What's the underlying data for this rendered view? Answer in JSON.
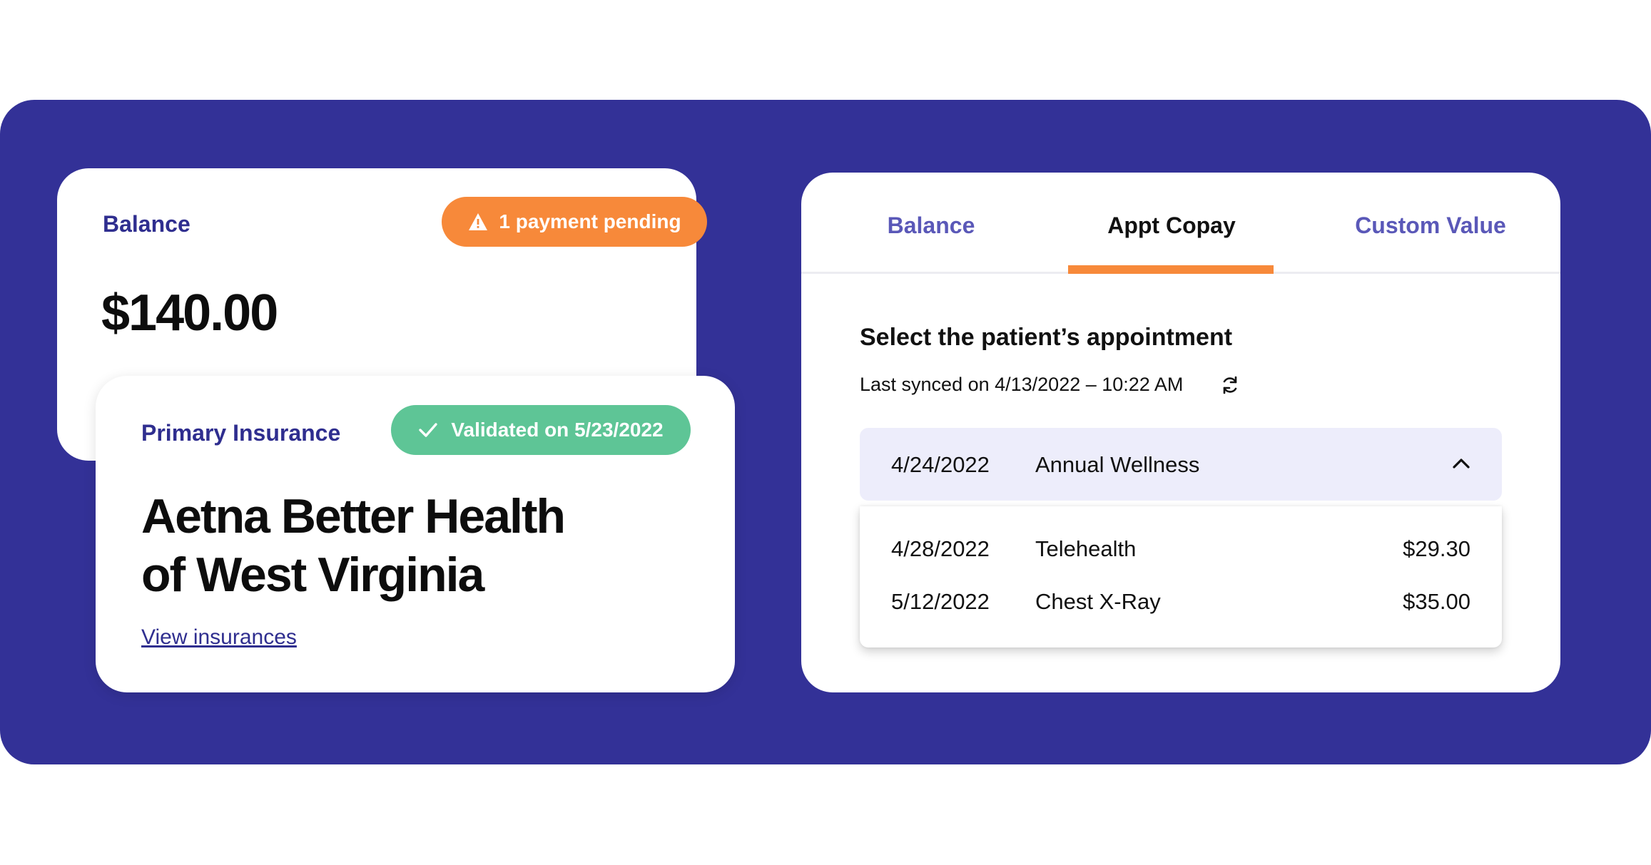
{
  "balance_card": {
    "label": "Balance",
    "pending_badge": "1 payment pending",
    "amount": "$140.00"
  },
  "insurance_card": {
    "label": "Primary Insurance",
    "validated_badge": "Validated on 5/23/2022",
    "name_line1": "Aetna Better Health",
    "name_line2": "of West Virginia",
    "link": "View insurances"
  },
  "appt_card": {
    "tabs": [
      {
        "label": "Balance",
        "active": false
      },
      {
        "label": "Appt Copay",
        "active": true
      },
      {
        "label": "Custom Value",
        "active": false
      }
    ],
    "title": "Select the patient’s appointment",
    "synced": "Last synced on 4/13/2022 – 10:22 AM",
    "selected": {
      "date": "4/24/2022",
      "name": "Annual Wellness"
    },
    "options": [
      {
        "date": "4/28/2022",
        "name": "Telehealth",
        "amount": "$29.30"
      },
      {
        "date": "5/12/2022",
        "name": "Chest X-Ray",
        "amount": "$35.00"
      }
    ]
  },
  "icons": {
    "warning": "warning-icon",
    "check": "check-icon",
    "sync": "sync-icon",
    "chevron": "chevron-up-icon"
  },
  "colors": {
    "background": "#333197",
    "accent_orange": "#f7893a",
    "accent_green": "#5ec596",
    "label_purple": "#2f2e8f",
    "selected_row": "#ededfb"
  }
}
